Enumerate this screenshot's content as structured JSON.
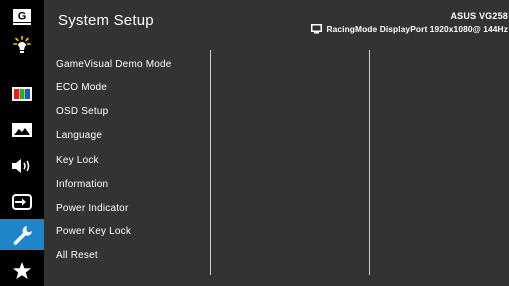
{
  "sidebar": {
    "items": [
      {
        "icon": "g-box-icon"
      },
      {
        "icon": "brightness-icon"
      },
      {
        "icon": "color-icon"
      },
      {
        "icon": "image-icon"
      },
      {
        "icon": "sound-icon"
      },
      {
        "icon": "input-select-icon"
      },
      {
        "icon": "system-setup-icon",
        "active": true
      },
      {
        "icon": "star-icon"
      }
    ],
    "g_label": "G"
  },
  "header": {
    "title": "System Setup",
    "model": "ASUS VG258",
    "status": "RacingMode DisplayPort 1920x1080@ 144Hz"
  },
  "menu": {
    "items": [
      "GameVisual Demo Mode",
      "ECO Mode",
      "OSD Setup",
      "Language",
      "Key Lock",
      "Information",
      "Power Indicator",
      "Power Key Lock",
      "All Reset"
    ]
  },
  "colors": {
    "accent": "#1e86c8",
    "panel": "#333333",
    "sidebar": "#000000"
  }
}
